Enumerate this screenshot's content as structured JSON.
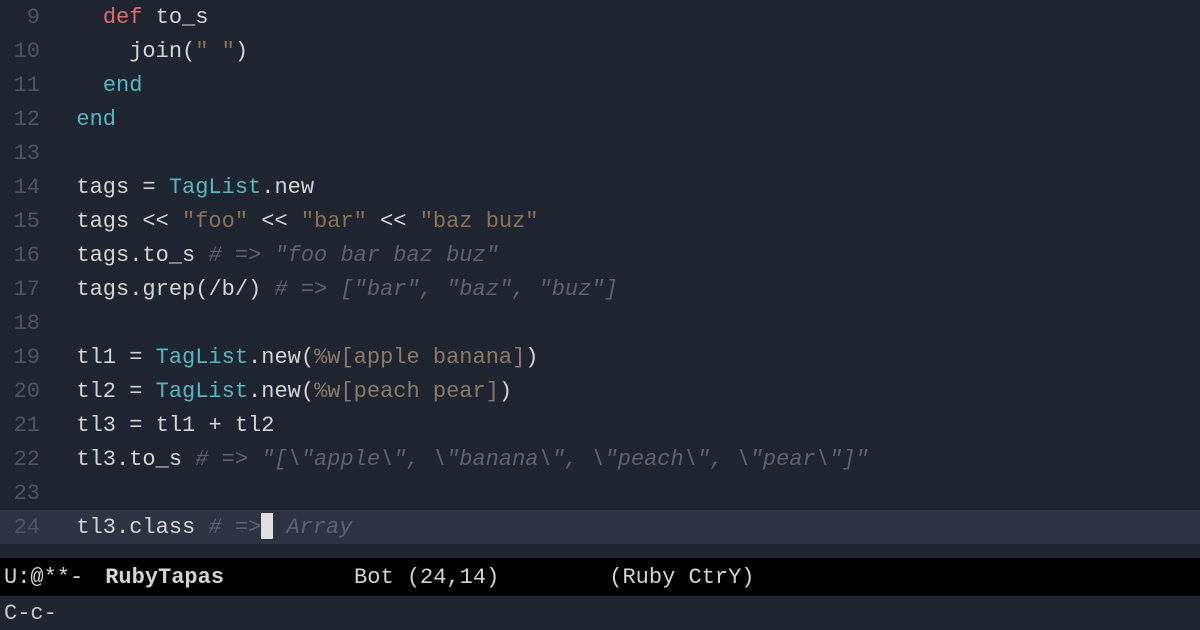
{
  "lines": {
    "9": {
      "indent": "    ",
      "tokens": [
        [
          "kw-def",
          "def "
        ],
        [
          "method",
          "to_s"
        ]
      ]
    },
    "10": {
      "indent": "      ",
      "tokens": [
        [
          "ident",
          "join"
        ],
        [
          "paren",
          "("
        ],
        [
          "str",
          "\" \""
        ],
        [
          "paren",
          ")"
        ]
      ]
    },
    "11": {
      "indent": "    ",
      "tokens": [
        [
          "kw-end",
          "end"
        ]
      ]
    },
    "12": {
      "indent": "  ",
      "tokens": [
        [
          "kw-end",
          "end"
        ]
      ]
    },
    "13": {
      "indent": "",
      "tokens": []
    },
    "14": {
      "indent": "  ",
      "tokens": [
        [
          "ident",
          "tags "
        ],
        [
          "op",
          "= "
        ],
        [
          "const",
          "TagList"
        ],
        [
          "ident",
          ".new"
        ]
      ]
    },
    "15": {
      "indent": "  ",
      "tokens": [
        [
          "ident",
          "tags "
        ],
        [
          "op",
          "<< "
        ],
        [
          "str",
          "\"foo\""
        ],
        [
          "op",
          " << "
        ],
        [
          "str",
          "\"bar\""
        ],
        [
          "op",
          " << "
        ],
        [
          "str",
          "\"baz buz\""
        ]
      ]
    },
    "16": {
      "indent": "  ",
      "tokens": [
        [
          "ident",
          "tags.to_s "
        ],
        [
          "comment",
          "# => \"foo bar baz buz\""
        ]
      ]
    },
    "17": {
      "indent": "  ",
      "tokens": [
        [
          "ident",
          "tags.grep"
        ],
        [
          "paren",
          "("
        ],
        [
          "regex",
          "/b/"
        ],
        [
          "paren",
          ") "
        ],
        [
          "comment",
          "# => [\"bar\", \"baz\", \"buz\"]"
        ]
      ]
    },
    "18": {
      "indent": "",
      "tokens": []
    },
    "19": {
      "indent": "  ",
      "tokens": [
        [
          "ident",
          "tl1 "
        ],
        [
          "op",
          "= "
        ],
        [
          "const",
          "TagList"
        ],
        [
          "ident",
          ".new"
        ],
        [
          "paren",
          "("
        ],
        [
          "str2",
          "%w[apple banana]"
        ],
        [
          "paren",
          ")"
        ]
      ]
    },
    "20": {
      "indent": "  ",
      "tokens": [
        [
          "ident",
          "tl2 "
        ],
        [
          "op",
          "= "
        ],
        [
          "const",
          "TagList"
        ],
        [
          "ident",
          ".new"
        ],
        [
          "paren",
          "("
        ],
        [
          "str2",
          "%w[peach pear]"
        ],
        [
          "paren",
          ")"
        ]
      ]
    },
    "21": {
      "indent": "  ",
      "tokens": [
        [
          "ident",
          "tl3 "
        ],
        [
          "op",
          "= "
        ],
        [
          "ident",
          "tl1 "
        ],
        [
          "op",
          "+ "
        ],
        [
          "ident",
          "tl2"
        ]
      ]
    },
    "22": {
      "indent": "  ",
      "tokens": [
        [
          "ident",
          "tl3.to_s "
        ],
        [
          "comment",
          "# => \"[\\\"apple\\\", \\\"banana\\\", \\\"peach\\\", \\\"pear\\\"]\""
        ]
      ]
    },
    "23": {
      "indent": "",
      "tokens": []
    },
    "24": {
      "indent": "  ",
      "tokens": [
        [
          "ident",
          "tl3.class "
        ],
        [
          "comment",
          "# =>"
        ],
        [
          "cursor",
          ""
        ],
        [
          "comment",
          " Array"
        ]
      ]
    }
  },
  "gutter": {
    "9": "9",
    "10": "10",
    "11": "11",
    "12": "12",
    "13": "13",
    "14": "14",
    "15": "15",
    "16": "16",
    "17": "17",
    "18": "18",
    "19": "19",
    "20": "20",
    "21": "21",
    "22": "22",
    "23": "23",
    "24": "24"
  },
  "currentLine": "24",
  "modeline": {
    "status": "U:@**-",
    "buffer": "RubyTapas",
    "position": "Bot (24,14)",
    "mode": "(Ruby CtrY)"
  },
  "minibuffer": "C-c-"
}
